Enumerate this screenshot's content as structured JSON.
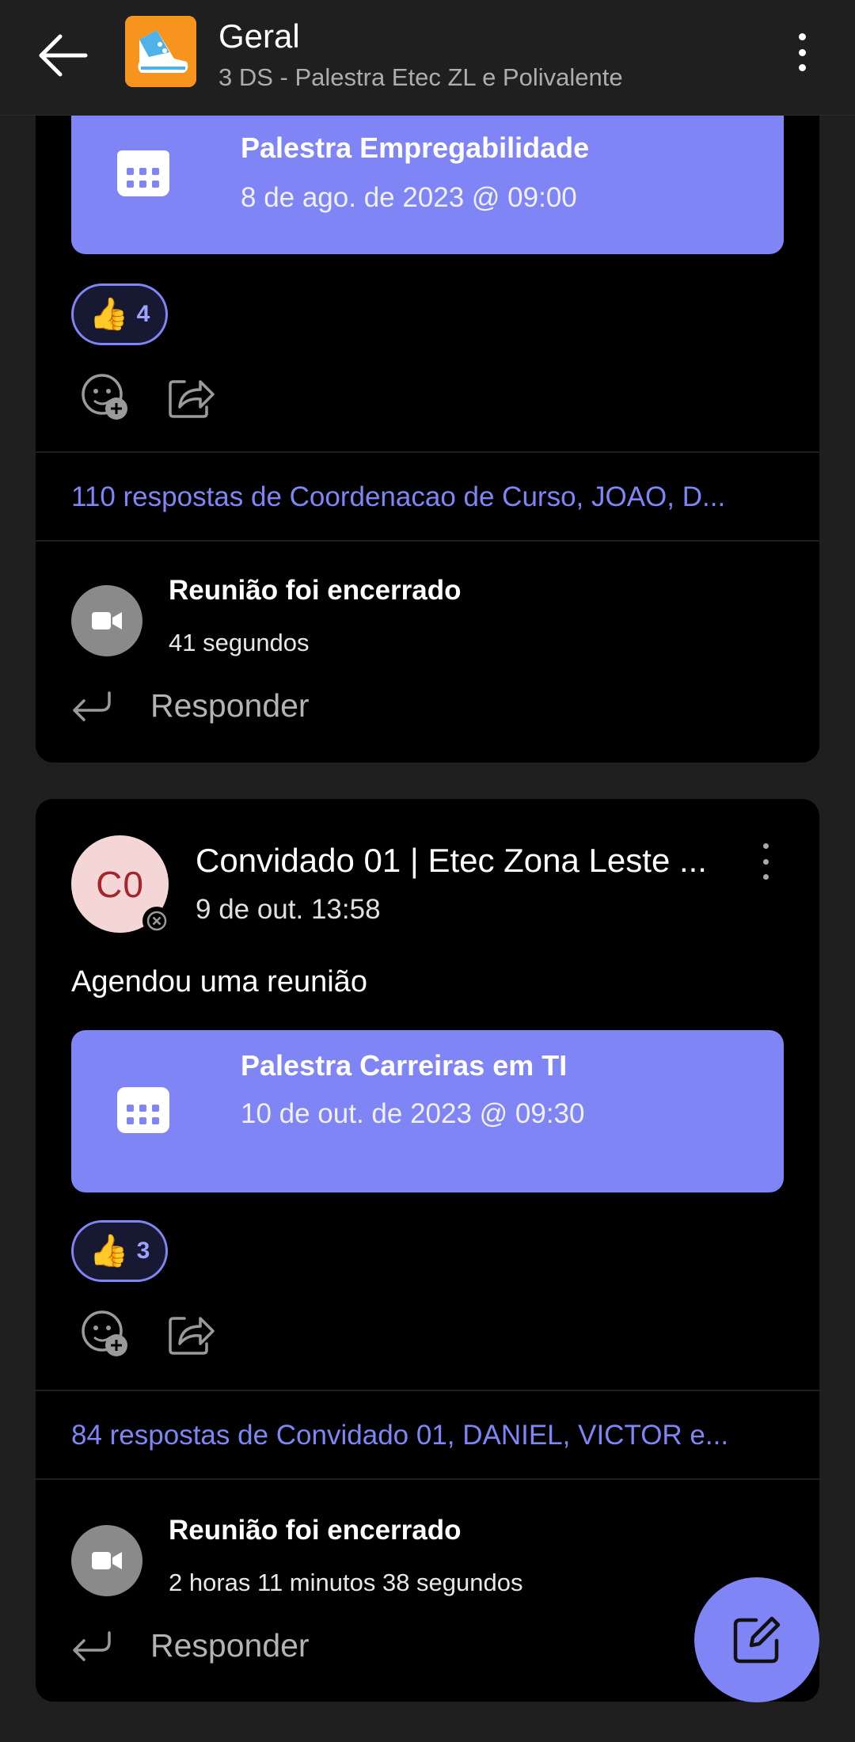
{
  "header": {
    "title": "Geral",
    "subtitle": "3 DS - Palestra Etec ZL e Polivalente",
    "back_icon": "arrow-left-icon",
    "more_icon": "more-vertical-icon",
    "team_avatar_color": "#f7941d"
  },
  "post1": {
    "event": {
      "title": "Palestra Empregabilidade",
      "date": "8 de ago. de 2023 @ 09:00"
    },
    "reaction": {
      "emoji": "👍",
      "count": "4"
    },
    "replies": "110 respostas de Coordenacao de Curso, JOAO, D...",
    "meeting": {
      "title": "Reunião foi encerrado",
      "duration": "41 segundos"
    },
    "reply_label": "Responder"
  },
  "post2": {
    "avatar_initials": "C0",
    "author": "Convidado 01 | Etec Zona Leste ...",
    "time": "9 de out. 13:58",
    "text": "Agendou uma reunião",
    "event": {
      "title": "Palestra Carreiras em TI",
      "date": "10 de out. de 2023 @ 09:30"
    },
    "reaction": {
      "emoji": "👍",
      "count": "3"
    },
    "replies": "84 respostas de Convidado 01, DANIEL, VICTOR e...",
    "meeting": {
      "title": "Reunião foi encerrado",
      "duration": "2 horas 11 minutos 38 segundos"
    },
    "reply_label": "Responder"
  },
  "fab_icon": "compose-icon",
  "colors": {
    "accent": "#7f85f5",
    "background": "#1f1f1f",
    "card": "#000000"
  }
}
